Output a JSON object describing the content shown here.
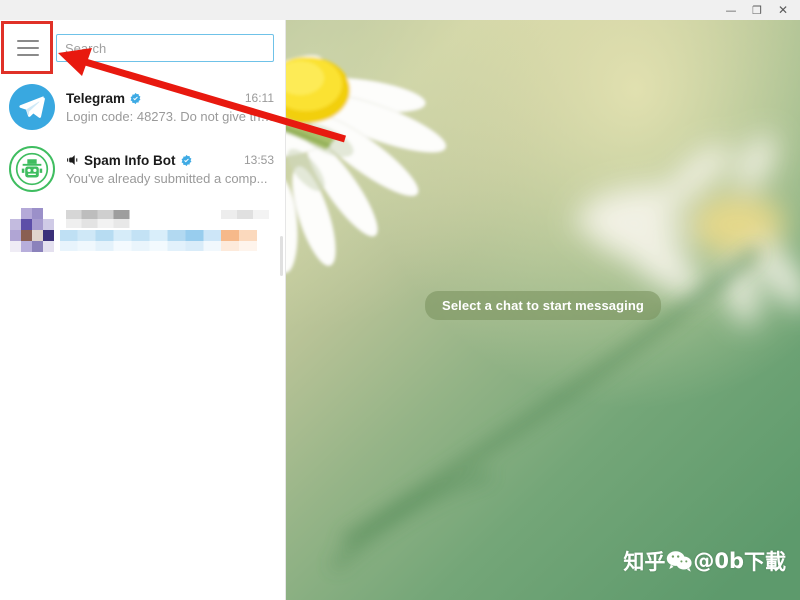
{
  "window": {
    "controls": [
      {
        "name": "minimize",
        "glyph": "—"
      },
      {
        "name": "maximize",
        "glyph": "❐"
      },
      {
        "name": "close",
        "glyph": "✕"
      }
    ]
  },
  "sidebar": {
    "menu_button_label": "menu",
    "search": {
      "placeholder": "Search",
      "value": ""
    },
    "chats": [
      {
        "name": "Telegram",
        "verified": true,
        "muted": false,
        "time": "16:11",
        "preview": "Login code: 48273. Do not give thi...",
        "avatar_type": "telegram-logo"
      },
      {
        "name": "Spam Info Bot",
        "verified": true,
        "muted": true,
        "time": "13:53",
        "preview": "You've already submitted a comp...",
        "avatar_type": "bot-sheriff"
      },
      {
        "name": "",
        "verified": false,
        "muted": false,
        "time": "",
        "preview": "",
        "avatar_type": "censored",
        "censored": true
      }
    ]
  },
  "main": {
    "placeholder_text": "Select a chat to start messaging",
    "background": "blurred daisy flower photo"
  },
  "watermark": {
    "prefix": "知乎",
    "handle": "@0b",
    "suffix": "下載",
    "icon": "wechat-icon"
  },
  "annotation": {
    "highlight_color": "#e03127",
    "arrow_color": "#e8190f",
    "target": "menu-button"
  },
  "colors": {
    "titlebar_bg": "#f0f0f0",
    "panel_bg": "#ffffff",
    "accent_blue": "#39a8e0",
    "search_border": "#6fc2e8",
    "bot_green": "#3fbd60",
    "muted_text": "#9a9a9a",
    "pill_bg": "rgba(124,148,97,0.62)"
  }
}
